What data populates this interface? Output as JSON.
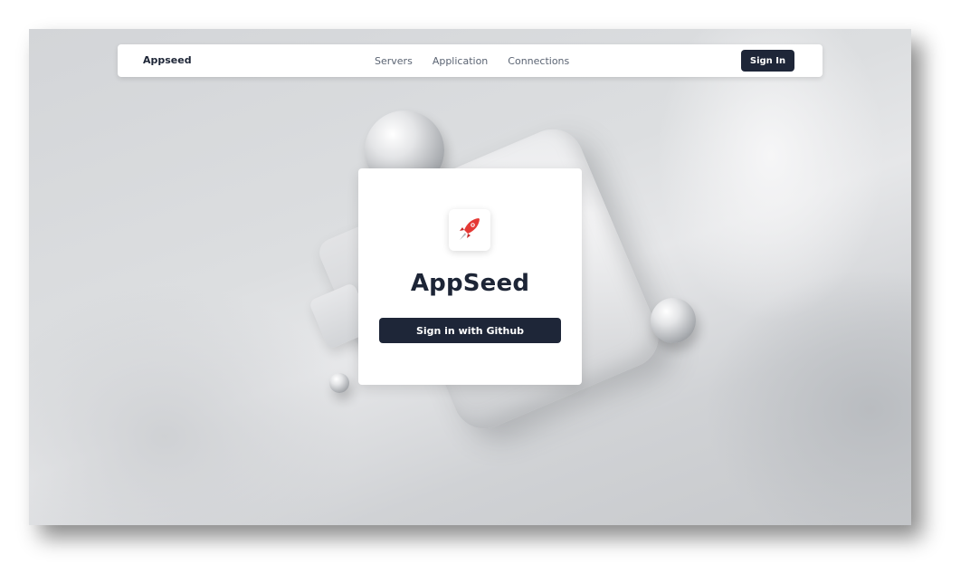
{
  "navbar": {
    "brand": "Appseed",
    "links": [
      {
        "label": "Servers"
      },
      {
        "label": "Application"
      },
      {
        "label": "Connections"
      }
    ],
    "signin_label": "Sign In"
  },
  "card": {
    "logo_icon": "rocket-icon",
    "title": "AppSeed",
    "github_button_label": "Sign in with Github"
  },
  "colors": {
    "primary_dark": "#1e2638",
    "rocket_red": "#e53935"
  }
}
